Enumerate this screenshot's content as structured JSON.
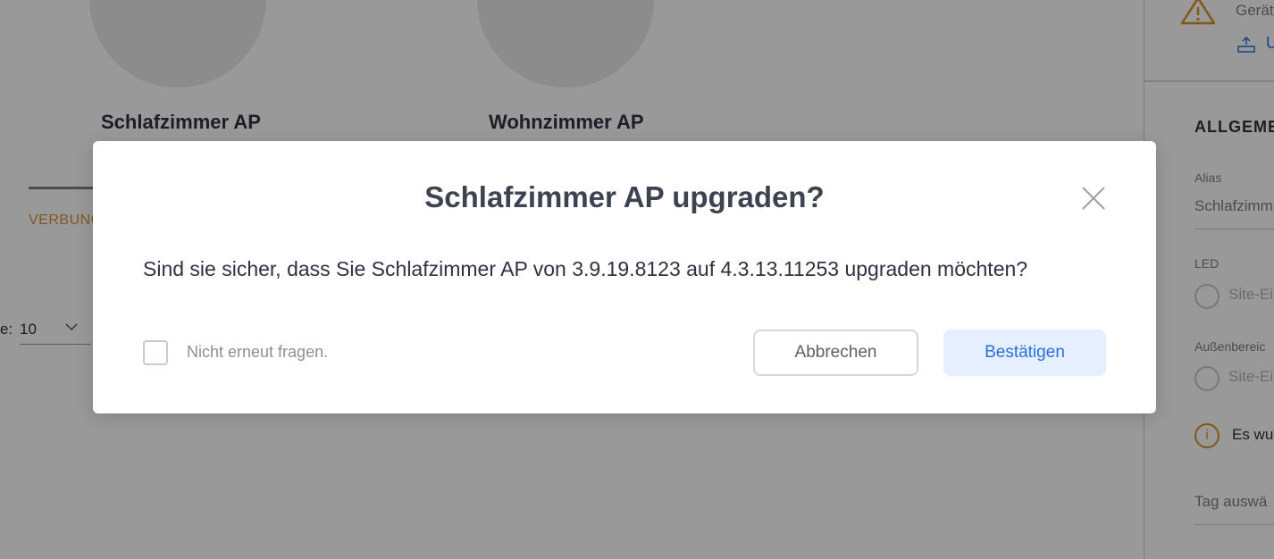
{
  "background": {
    "devices": [
      {
        "name": "Schlafzimmer AP"
      },
      {
        "name": "Wohnzimmer AP"
      }
    ],
    "tab_label": "VERBUNG",
    "rows_per_page": {
      "label": "e:",
      "value": "10"
    }
  },
  "side_panel": {
    "device_status": "Gerät",
    "upgrade_link": "U",
    "section_heading": "ALLGEMEI",
    "alias": {
      "label": "Alias",
      "value": "Schlafzimm"
    },
    "led": {
      "label": "LED",
      "option": "Site-Ei"
    },
    "outdoor": {
      "label": "Außenbereic",
      "option": "Site-Ei"
    },
    "info_text": "Es wu",
    "tag_placeholder": "Tag auswä"
  },
  "modal": {
    "title": "Schlafzimmer AP upgraden?",
    "message": "Sind sie sicher, dass Sie Schlafzimmer AP von 3.9.19.8123 auf 4.3.13.11253 upgraden möchten?",
    "dont_ask_again_label": "Nicht erneut fragen.",
    "cancel_label": "Abbrechen",
    "confirm_label": "Bestätigen"
  },
  "colors": {
    "accent": "#2a6fe0",
    "warning": "#d9902d",
    "confirm_bg": "#e6effd"
  }
}
